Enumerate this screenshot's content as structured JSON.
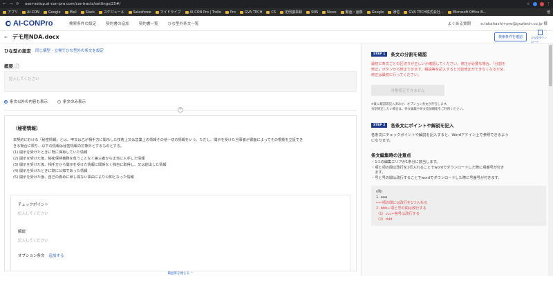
{
  "browser": {
    "url": "user-setup.ai-con-pro.com/contracts/settings/25#/",
    "bookmarks": [
      "アプリ",
      "AI-CON",
      "Google",
      "Mail",
      "Slack",
      "スケジュール",
      "Salesforce",
      "マイドライブ",
      "AI-CON Pro | Trello",
      "Pro",
      "GVA TECH",
      "CS",
      "定例議事録",
      "SNS",
      "News",
      "動画・画像",
      "Google",
      "通信",
      "GVA TECH株式会社...",
      "Microsoft Office B..."
    ],
    "other_bookmarks": "他"
  },
  "app": {
    "logo": "AI-CONPro",
    "nav": [
      "検索条件の設定",
      "契約書の追加",
      "契約書一覧",
      "ひな型外条文一覧"
    ],
    "faq": "よくある質問",
    "user": "e.takahashi+pro@gvatech.co.jp 様"
  },
  "titlebar": {
    "back": "←",
    "title": "デモ用NDA.docx",
    "search_btn": "検索条件を確認",
    "download": "ひな型ダウンロード"
  },
  "left": {
    "settings_label": "ひな型の設定",
    "settings_link": "同じ構型・立場でひな型外の条文を設定",
    "summary_label": "概要",
    "summary_placeholder": "記入してください",
    "radio1": "条文以外の内容も表示",
    "radio2": "条文のみ表示",
    "clause_title": "（秘密情報）",
    "clause_lines": [
      "本契約における「秘密情報」とは、甲又は乙が相手方に開示した技術上又は営業上の情報その他一切の情報をいう。ただし、開示を受けた当事者が書面によってその根拠を立証でき",
      "きる場合に限り、以下の情報は秘密情報の対象外とするものとする。",
      "(1) 開示を受けたときに既に保有していた情報",
      "(2) 開示を受けた後、秘密保持義務を負うことなく第三者から正当に入手した情報",
      "(3) 開示を受けた後、相手方から開示を受けた情報に関係なく独自に取得し、又は創出した情報",
      "(4) 開示を受けたときに既に公知であった情報",
      "(5) 開示を受けた後、自己の責めに帰し得ない事由により公知となった情報"
    ],
    "checkpoint_label": "チェックポイント",
    "checkpoint_placeholder": "記入してください",
    "explain_label": "解説",
    "explain_placeholder": "記入してください",
    "option_label": "オプション条文",
    "option_link": "追加する",
    "bottom_link": "範囲等を閉じる"
  },
  "right": {
    "step1_badge": "STEP 1",
    "step1_title": "条文の分割を確認",
    "step1_red": [
      "最初に条文ごとの区切りが正しいか確認してください。修正が必要な場合、「分割を",
      "修正」ボタンから修正できます。解説等を記入すると分割修正ができなくなるため、",
      "修正は最初に行ってください。"
    ],
    "step1_btn": "分割修正できません",
    "step1_notes": [
      "※既に解説等記入済みか、オプション条文が存在します。",
      "分割修正したい場合は、条文編集や条文追加機能をご利用ください。"
    ],
    "step2_badge": "STEP 2",
    "step2_title": "各条文にポイントや解説を記入",
    "step2_desc": [
      "各条文にチェックポイントや解説を記入すると、Wordアドイン上で参照できるよう",
      "になります。"
    ],
    "edit_title": "条文編集時の注意点",
    "edit_bullets": [
      "・1つの編集エリアが1条分に該当します。",
      "・項と項の間は改行を1行入れることでwordでダウンロードした際に項番号が付き",
      "　ます。",
      "・号と号の間は改行することでwordでダウンロードした際に号番号が付きます。"
    ],
    "example": [
      "(例)",
      "1. aaa",
      "←←項の間には改行を1つ入れる",
      "2. bbb←項と号の間は改行する",
      "（1）ccc←各号は改行する",
      "（2）ddd"
    ]
  }
}
